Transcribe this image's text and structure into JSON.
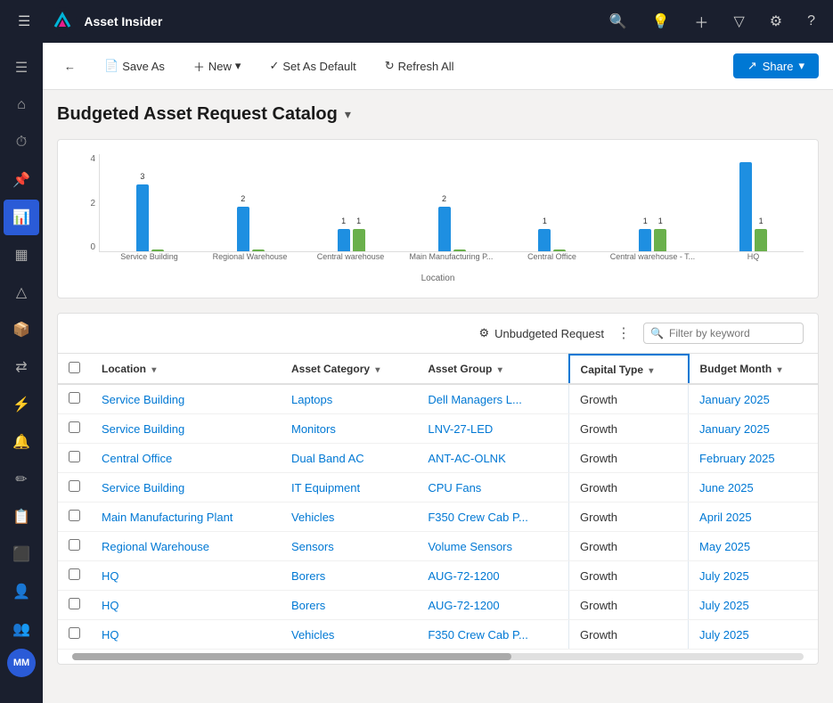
{
  "app": {
    "title": "Asset Insider"
  },
  "topnav": {
    "icons": [
      "search",
      "lightbulb",
      "plus",
      "filter",
      "settings",
      "question"
    ]
  },
  "toolbar": {
    "back_label": "←",
    "save_as_label": "Save As",
    "new_label": "New",
    "set_default_label": "Set As Default",
    "refresh_label": "Refresh All",
    "share_label": "Share"
  },
  "page": {
    "title": "Budgeted Asset Request Catalog",
    "grid_filter_placeholder": "Filter by keyword",
    "unbudgeted_label": "Unbudgeted Request"
  },
  "chart": {
    "y_labels": [
      "4",
      "2",
      "0"
    ],
    "x_axis_title": "Location",
    "groups": [
      {
        "label": "Service Building",
        "blue": 3,
        "green": 0,
        "blue_val": "3",
        "green_val": ""
      },
      {
        "label": "Regional Warehouse",
        "blue": 2,
        "green": 0,
        "blue_val": "2",
        "green_val": ""
      },
      {
        "label": "Central warehouse",
        "blue": 1,
        "green": 1,
        "blue_val": "1",
        "green_val": "1"
      },
      {
        "label": "Main Manufacturing P...",
        "blue": 2,
        "green": 0,
        "blue_val": "2",
        "green_val": ""
      },
      {
        "label": "Central Office",
        "blue": 1,
        "green": 0,
        "blue_val": "1",
        "green_val": ""
      },
      {
        "label": "Central warehouse - T...",
        "blue": 1,
        "green": 1,
        "blue_val": "1",
        "green_val": "1"
      },
      {
        "label": "HQ",
        "blue": 4,
        "green": 1,
        "blue_val": "",
        "green_val": "1"
      }
    ]
  },
  "table": {
    "columns": [
      {
        "id": "location",
        "label": "Location",
        "sort": true
      },
      {
        "id": "category",
        "label": "Asset Category",
        "sort": true
      },
      {
        "id": "group",
        "label": "Asset Group",
        "sort": true
      },
      {
        "id": "capital_type",
        "label": "Capital Type",
        "sort": true,
        "highlighted": true
      },
      {
        "id": "budget_month",
        "label": "Budget Month",
        "sort": true
      }
    ],
    "rows": [
      {
        "location": "Service Building",
        "category": "Laptops",
        "group": "Dell Managers L...",
        "capital_type": "Growth",
        "budget_month": "January 2025"
      },
      {
        "location": "Service Building",
        "category": "Monitors",
        "group": "LNV-27-LED",
        "capital_type": "Growth",
        "budget_month": "January 2025"
      },
      {
        "location": "Central Office",
        "category": "Dual Band AC",
        "group": "ANT-AC-OLNK",
        "capital_type": "Growth",
        "budget_month": "February 2025"
      },
      {
        "location": "Service Building",
        "category": "IT Equipment",
        "group": "CPU Fans",
        "capital_type": "Growth",
        "budget_month": "June 2025"
      },
      {
        "location": "Main Manufacturing Plant",
        "category": "Vehicles",
        "group": "F350 Crew Cab P...",
        "capital_type": "Growth",
        "budget_month": "April 2025"
      },
      {
        "location": "Regional Warehouse",
        "category": "Sensors",
        "group": "Volume Sensors",
        "capital_type": "Growth",
        "budget_month": "May 2025"
      },
      {
        "location": "HQ",
        "category": "Borers",
        "group": "AUG-72-1200",
        "capital_type": "Growth",
        "budget_month": "July 2025"
      },
      {
        "location": "HQ",
        "category": "Borers",
        "group": "AUG-72-1200",
        "capital_type": "Growth",
        "budget_month": "July 2025"
      },
      {
        "location": "HQ",
        "category": "Vehicles",
        "group": "F350 Crew Cab P...",
        "capital_type": "Growth",
        "budget_month": "July 2025"
      }
    ]
  },
  "sidebar": {
    "items": [
      {
        "icon": "☰",
        "name": "hamburger"
      },
      {
        "icon": "⌂",
        "name": "home"
      },
      {
        "icon": "⏱",
        "name": "recent"
      },
      {
        "icon": "📌",
        "name": "pinned"
      },
      {
        "icon": "📊",
        "name": "charts",
        "active": true
      },
      {
        "icon": "📅",
        "name": "calendar"
      },
      {
        "icon": "⚠",
        "name": "alerts"
      },
      {
        "icon": "📦",
        "name": "assets"
      },
      {
        "icon": "🔀",
        "name": "shuffle"
      },
      {
        "icon": "⚡",
        "name": "lightning"
      },
      {
        "icon": "🔔",
        "name": "notifications"
      },
      {
        "icon": "✏",
        "name": "edit"
      },
      {
        "icon": "📋",
        "name": "clipboard"
      },
      {
        "icon": "🔲",
        "name": "layers"
      },
      {
        "icon": "👤",
        "name": "user"
      },
      {
        "icon": "👥",
        "name": "team"
      },
      {
        "icon": "⬇",
        "name": "download"
      }
    ],
    "avatar": "MM"
  }
}
